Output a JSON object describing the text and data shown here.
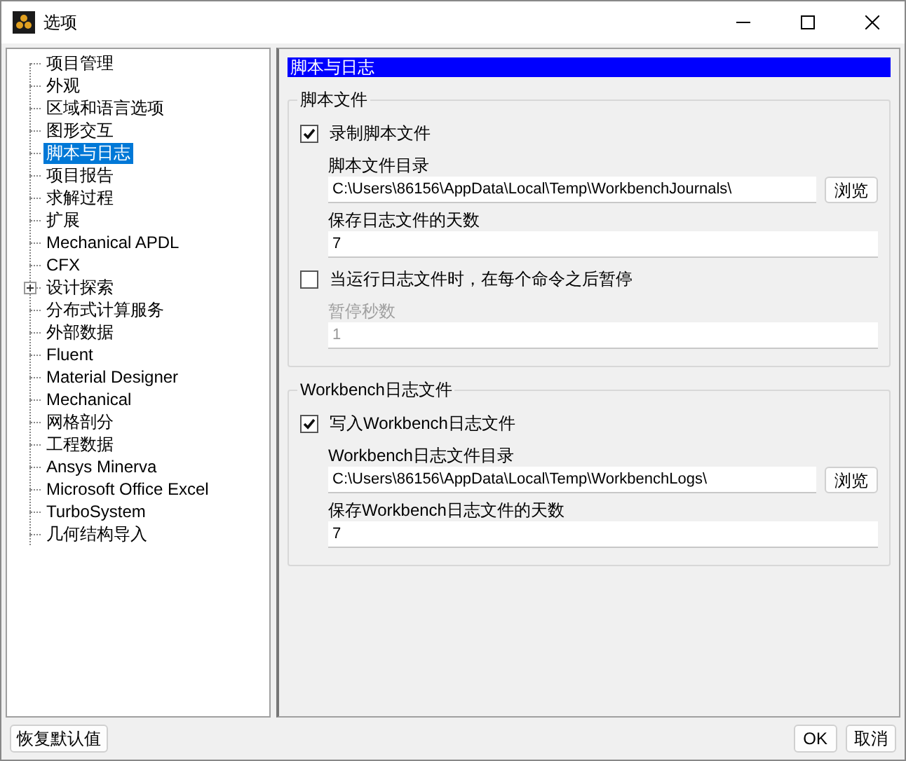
{
  "window": {
    "title": "选项"
  },
  "sidebar": {
    "items": [
      {
        "label": "项目管理",
        "selected": false,
        "kind": "leaf"
      },
      {
        "label": "外观",
        "selected": false,
        "kind": "leaf"
      },
      {
        "label": "区域和语言选项",
        "selected": false,
        "kind": "leaf"
      },
      {
        "label": "图形交互",
        "selected": false,
        "kind": "leaf"
      },
      {
        "label": "脚本与日志",
        "selected": true,
        "kind": "leaf"
      },
      {
        "label": "项目报告",
        "selected": false,
        "kind": "leaf"
      },
      {
        "label": "求解过程",
        "selected": false,
        "kind": "leaf"
      },
      {
        "label": "扩展",
        "selected": false,
        "kind": "leaf"
      },
      {
        "label": "Mechanical APDL",
        "selected": false,
        "kind": "leaf"
      },
      {
        "label": "CFX",
        "selected": false,
        "kind": "leaf"
      },
      {
        "label": "设计探索",
        "selected": false,
        "kind": "collapsed"
      },
      {
        "label": "分布式计算服务",
        "selected": false,
        "kind": "leaf"
      },
      {
        "label": "外部数据",
        "selected": false,
        "kind": "leaf"
      },
      {
        "label": "Fluent",
        "selected": false,
        "kind": "leaf"
      },
      {
        "label": "Material Designer",
        "selected": false,
        "kind": "leaf"
      },
      {
        "label": "Mechanical",
        "selected": false,
        "kind": "leaf"
      },
      {
        "label": "网格剖分",
        "selected": false,
        "kind": "leaf"
      },
      {
        "label": "工程数据",
        "selected": false,
        "kind": "leaf"
      },
      {
        "label": "Ansys Minerva",
        "selected": false,
        "kind": "leaf"
      },
      {
        "label": "Microsoft Office Excel",
        "selected": false,
        "kind": "leaf"
      },
      {
        "label": "TurboSystem",
        "selected": false,
        "kind": "leaf"
      },
      {
        "label": "几何结构导入",
        "selected": false,
        "kind": "leaf"
      }
    ]
  },
  "panel": {
    "header": "脚本与日志",
    "groups": [
      {
        "title": "脚本文件",
        "items": [
          {
            "kind": "checkbox",
            "label": "录制脚本文件",
            "checked": true
          },
          {
            "kind": "path",
            "label": "脚本文件目录",
            "value": "C:\\Users\\86156\\AppData\\Local\\Temp\\WorkbenchJournals\\",
            "button": "浏览",
            "disabled": false
          },
          {
            "kind": "field",
            "label": "保存日志文件的天数",
            "value": "7",
            "disabled": false
          },
          {
            "kind": "checkbox",
            "label": "当运行日志文件时，在每个命令之后暂停",
            "checked": false
          },
          {
            "kind": "field",
            "label": "暂停秒数",
            "value": "1",
            "disabled": true
          }
        ]
      },
      {
        "title": "Workbench日志文件",
        "items": [
          {
            "kind": "checkbox",
            "label": "写入Workbench日志文件",
            "checked": true
          },
          {
            "kind": "path",
            "label": "Workbench日志文件目录",
            "value": "C:\\Users\\86156\\AppData\\Local\\Temp\\WorkbenchLogs\\",
            "button": "浏览",
            "disabled": false
          },
          {
            "kind": "field",
            "label": "保存Workbench日志文件的天数",
            "value": "7",
            "disabled": false
          }
        ]
      }
    ]
  },
  "footer": {
    "reset": "恢复默认值",
    "ok": "OK",
    "cancel": "取消"
  }
}
